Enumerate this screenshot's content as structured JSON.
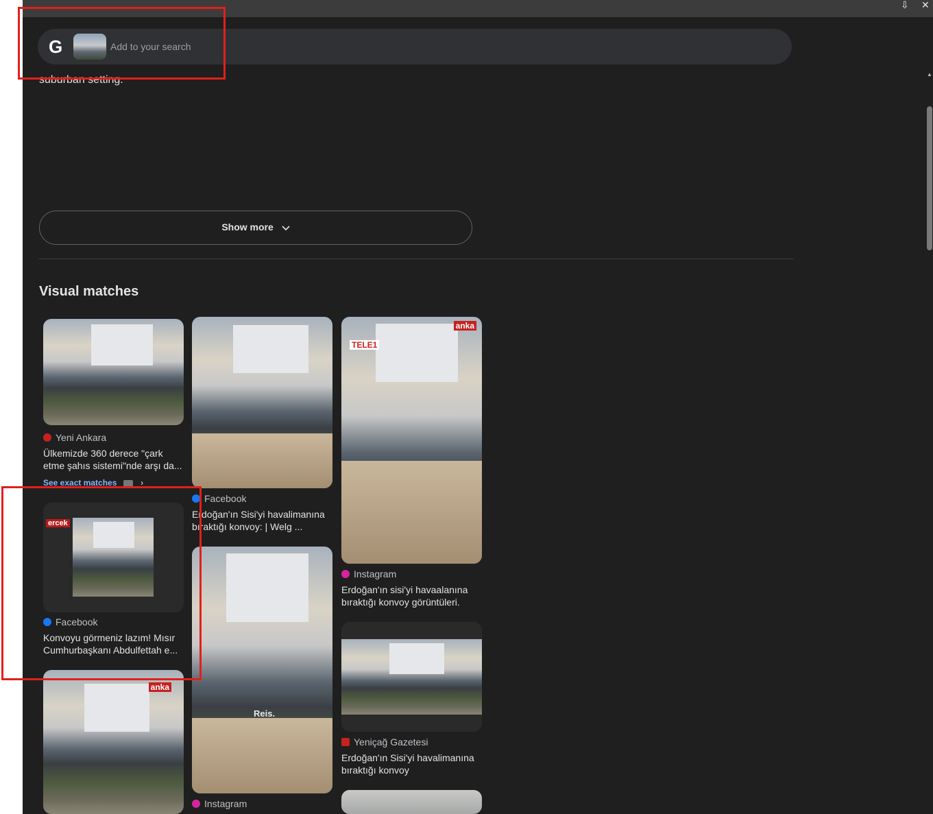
{
  "window": {
    "pin_label": "⇩",
    "close_label": "✕"
  },
  "search": {
    "logo_text": "G",
    "placeholder": "Add to your search"
  },
  "description": {
    "cut_text": "suburban setting."
  },
  "show_more": {
    "label": "Show more"
  },
  "visual_matches": {
    "title": "Visual matches",
    "cards": [
      {
        "source": "Yeni Ankara",
        "caption": "Ülkemizde 360 derece \"çark etme şahıs sistemi\"nde arşı da...",
        "exact_link": "See exact matches",
        "icon_color": "#c5221f"
      },
      {
        "source": "Facebook",
        "caption": "Erdoğan'ın Sisi'yi havalimanına bıraktığı konvoy: | Welg ...",
        "icon_color": "#1877f2"
      },
      {
        "source": "Instagram",
        "caption": "Erdoğan'ın sisi'yi havaalanına bıraktığı konvoy görüntüleri.",
        "icon_color": "#d6249f",
        "overlay": "TELE1",
        "watermark": "anka"
      },
      {
        "source": "Facebook",
        "caption": "Konvoyu görmeniz lazım! Mısır Cumhurbaşkanı Abdulfettah e...",
        "icon_color": "#1877f2",
        "overlay": "ercek"
      },
      {
        "source": "Instagram",
        "caption": "",
        "icon_color": "#d6249f",
        "watermark": "Reis."
      },
      {
        "source": "Yeniçağ Gazetesi",
        "caption": "Erdoğan'ın Sisi'yi havalimanına bıraktığı konvoy",
        "icon_color": "#c5221f"
      },
      {
        "source": "",
        "caption": "",
        "watermark": "anka"
      }
    ]
  }
}
